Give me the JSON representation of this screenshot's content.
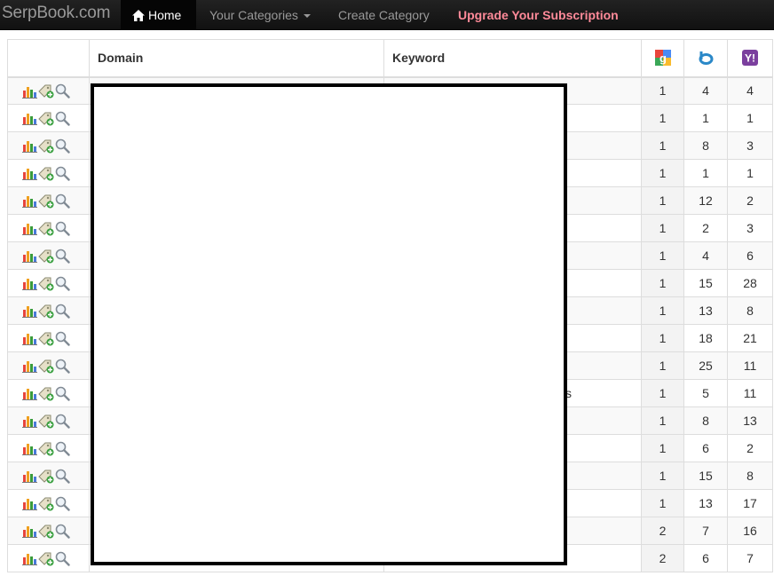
{
  "navbar": {
    "brand": "SerpBook.com",
    "home": "Home",
    "categories": "Your Categories",
    "create": "Create Category",
    "upgrade": "Upgrade Your Subscription"
  },
  "table": {
    "headers": {
      "domain": "Domain",
      "keyword": "Keyword"
    },
    "engines": [
      "google-icon",
      "bing-icon",
      "yahoo-icon"
    ],
    "rows": [
      {
        "google": "1",
        "bing": "4",
        "yahoo": "4",
        "keyword_fragment": ""
      },
      {
        "google": "1",
        "bing": "1",
        "yahoo": "1",
        "keyword_fragment": ""
      },
      {
        "google": "1",
        "bing": "8",
        "yahoo": "3",
        "keyword_fragment": ""
      },
      {
        "google": "1",
        "bing": "1",
        "yahoo": "1",
        "keyword_fragment": ""
      },
      {
        "google": "1",
        "bing": "12",
        "yahoo": "2",
        "keyword_fragment": ""
      },
      {
        "google": "1",
        "bing": "2",
        "yahoo": "3",
        "keyword_fragment": ""
      },
      {
        "google": "1",
        "bing": "4",
        "yahoo": "6",
        "keyword_fragment": ""
      },
      {
        "google": "1",
        "bing": "15",
        "yahoo": "28",
        "keyword_fragment": ""
      },
      {
        "google": "1",
        "bing": "13",
        "yahoo": "8",
        "keyword_fragment": ""
      },
      {
        "google": "1",
        "bing": "18",
        "yahoo": "21",
        "keyword_fragment": ""
      },
      {
        "google": "1",
        "bing": "25",
        "yahoo": "11",
        "keyword_fragment": ""
      },
      {
        "google": "1",
        "bing": "5",
        "yahoo": "11",
        "keyword_fragment": "s"
      },
      {
        "google": "1",
        "bing": "8",
        "yahoo": "13",
        "keyword_fragment": ""
      },
      {
        "google": "1",
        "bing": "6",
        "yahoo": "2",
        "keyword_fragment": ""
      },
      {
        "google": "1",
        "bing": "15",
        "yahoo": "8",
        "keyword_fragment": ""
      },
      {
        "google": "1",
        "bing": "13",
        "yahoo": "17",
        "keyword_fragment": ""
      },
      {
        "google": "2",
        "bing": "7",
        "yahoo": "16",
        "keyword_fragment": ""
      },
      {
        "google": "2",
        "bing": "6",
        "yahoo": "7",
        "keyword_fragment": ""
      }
    ]
  },
  "colors": {
    "navbar": "#1b1b1b",
    "upgrade": "#ff8a99",
    "redaction_border": "#000000"
  }
}
